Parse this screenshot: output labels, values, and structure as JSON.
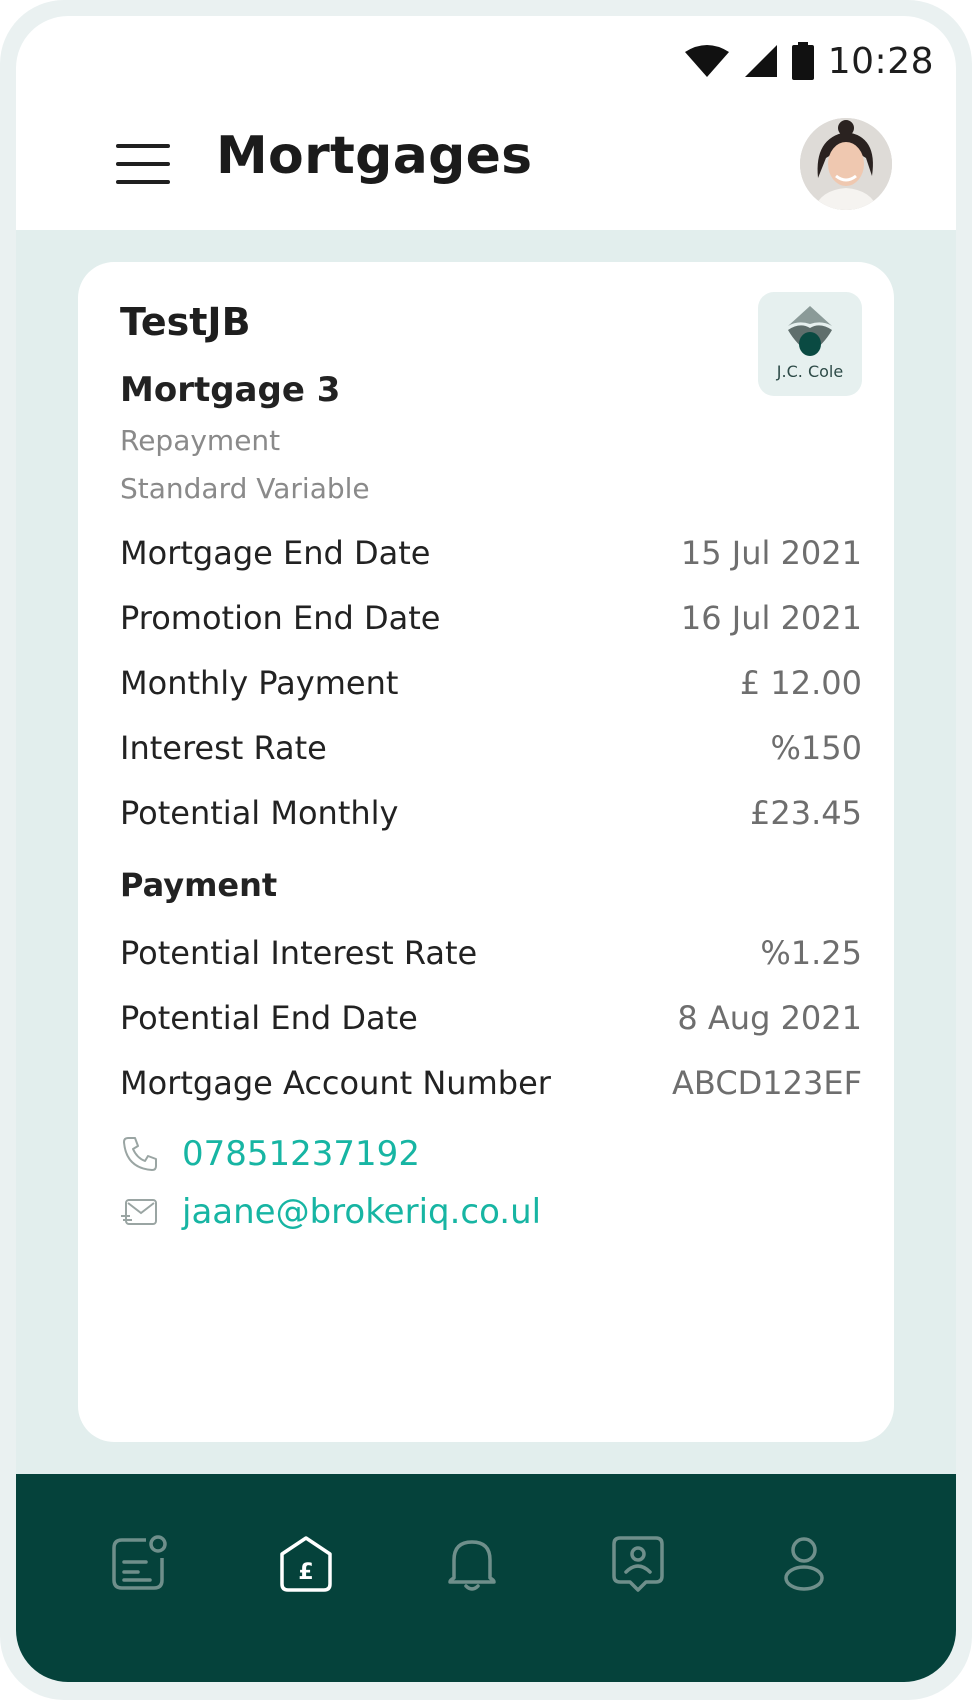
{
  "status_bar": {
    "time": "10:28",
    "icons": [
      "wifi-icon",
      "cellular-signal-icon",
      "battery-icon"
    ]
  },
  "header": {
    "title": "Mortgages",
    "menu_icon": "hamburger-menu-icon",
    "avatar": "user-avatar-photo"
  },
  "card": {
    "client_name": "TestJB",
    "mortgage_name": "Mortgage 3",
    "repayment_type": "Repayment",
    "rate_type": "Standard Variable",
    "lender_logo_text": "J.C. Cole",
    "details": [
      {
        "label": "Mortgage End Date",
        "value": "15 Jul 2021"
      },
      {
        "label": "Promotion End Date",
        "value": "16 Jul 2021"
      },
      {
        "label": "Monthly Payment",
        "value": "£ 12.00"
      },
      {
        "label": "Interest Rate",
        "value": "%150"
      },
      {
        "label": "Potential Monthly",
        "value": "£23.45"
      }
    ],
    "section_title": "Payment",
    "details2": [
      {
        "label": "Potential Interest Rate",
        "value": "%1.25"
      },
      {
        "label": "Potential End Date",
        "value": "8 Aug 2021"
      },
      {
        "label": "Mortgage Account Number",
        "value": "ABCD123EF"
      }
    ],
    "phone": "07851237192",
    "email": "jaane@brokeriq.co.ul"
  },
  "bottom_nav": {
    "items": [
      {
        "icon": "dashboard-icon",
        "active": false
      },
      {
        "icon": "mortgage-home-pound-icon",
        "active": true
      },
      {
        "icon": "bell-icon",
        "active": false
      },
      {
        "icon": "contact-card-icon",
        "active": false
      },
      {
        "icon": "profile-icon",
        "active": false
      }
    ]
  },
  "colors": {
    "accent": "#17b5a3",
    "nav_background": "#05423b",
    "page_background": "#e2eeed",
    "nav_icon_inactive": "#6f8f8b",
    "nav_icon_active": "#ffffff"
  }
}
